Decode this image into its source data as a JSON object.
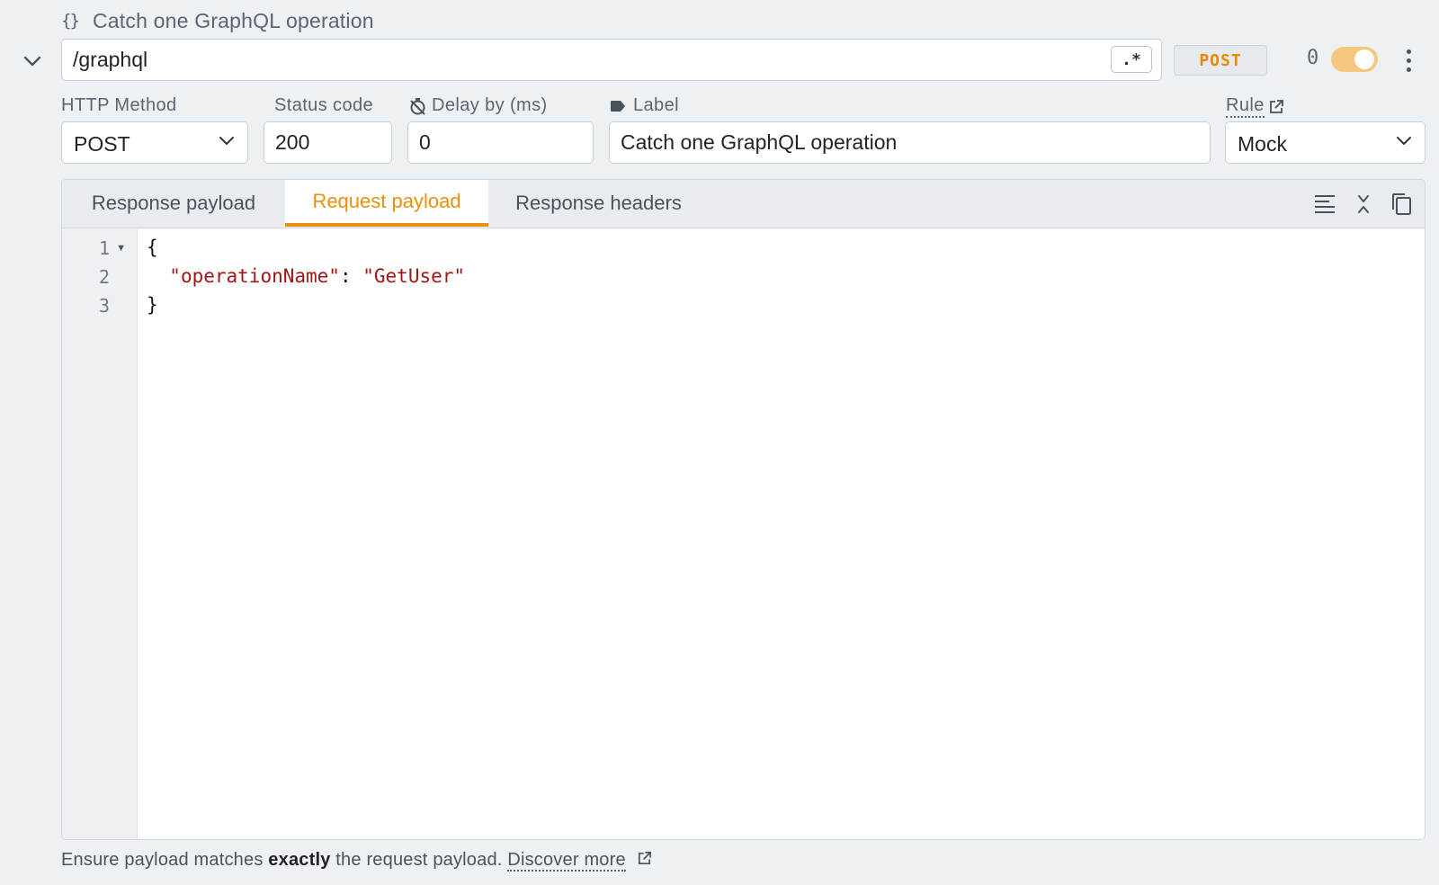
{
  "header": {
    "icon": "braces-icon",
    "title": "Catch one GraphQL operation"
  },
  "url": {
    "value": "/graphql",
    "regex_label": ".*"
  },
  "method_badge": "POST",
  "hit_count": "0",
  "enabled": true,
  "fields": {
    "http_method": {
      "label": "HTTP Method",
      "value": "POST"
    },
    "status_code": {
      "label": "Status code",
      "value": "200"
    },
    "delay": {
      "label": "Delay by (ms)",
      "value": "0"
    },
    "label": {
      "label": "Label",
      "value": "Catch one GraphQL operation"
    },
    "rule": {
      "label": "Rule",
      "value": "Mock"
    }
  },
  "tabs": [
    {
      "label": "Response payload",
      "active": false
    },
    {
      "label": "Request payload",
      "active": true
    },
    {
      "label": "Response headers",
      "active": false
    }
  ],
  "editor": {
    "line_numbers": [
      "1",
      "2",
      "3"
    ],
    "lines": {
      "open": "{",
      "key": "\"operationName\"",
      "colon": ": ",
      "value": "\"GetUser\"",
      "close": "}"
    }
  },
  "footer": {
    "prefix": "Ensure payload matches ",
    "bold": "exactly",
    "suffix": " the request payload. ",
    "link": "Discover more"
  },
  "colors": {
    "accent": "#e8900c",
    "toggle_on": "#f5c77e",
    "json_string": "#a31515"
  }
}
